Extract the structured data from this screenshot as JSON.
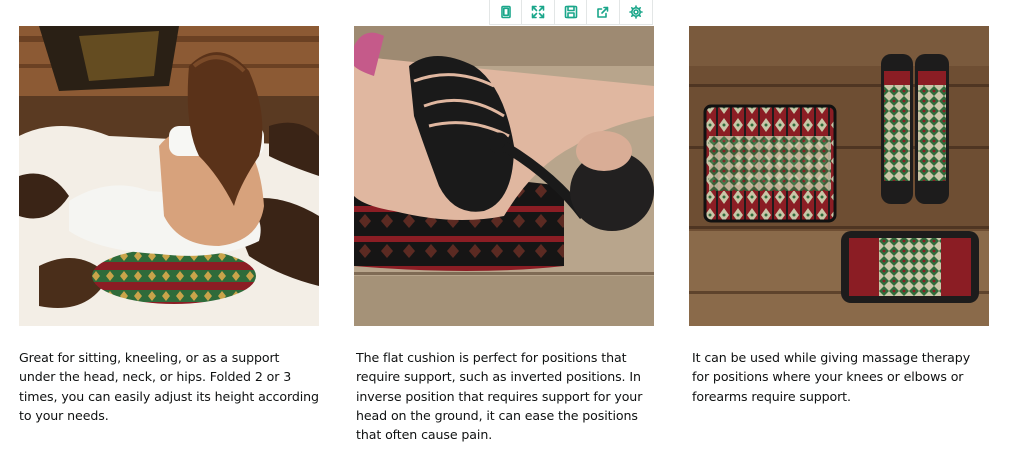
{
  "toolbar": {
    "icons": [
      "tablet-icon",
      "expand-icon",
      "save-icon",
      "share-icon",
      "settings-icon"
    ],
    "accent": "#1aa68a"
  },
  "tiles": [
    {
      "image": "woman-sitting-on-cushion",
      "caption": "Great for sitting, kneeling, or as a support under the head, neck, or hips. Folded 2 or 3 times, you can easily adjust its height according to your needs."
    },
    {
      "image": "woman-lying-on-cushion",
      "caption": "The flat cushion is perfect for positions that require support, such as inverted positions. In inverse position that requires support for your head on the ground, it can ease the positions that often cause pain."
    },
    {
      "image": "folded-cushions-on-floor",
      "caption": "It can be used while giving massage therapy for positions where your knees or elbows or forearms require support."
    }
  ]
}
